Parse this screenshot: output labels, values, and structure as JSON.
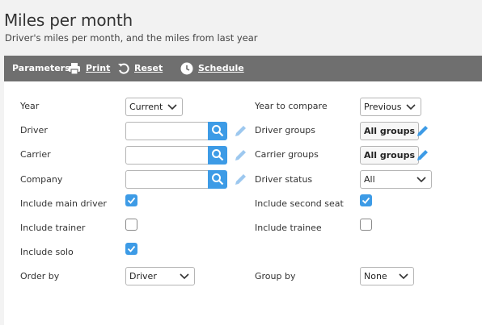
{
  "header": {
    "title": "Miles per month",
    "subtitle": "Driver's miles per month, and the miles from last year"
  },
  "toolbar": {
    "parameters_label": "Parameters",
    "print_label": "Print",
    "reset_label": "Reset",
    "schedule_label": "Schedule"
  },
  "form": {
    "year": {
      "label": "Year",
      "value": "Current"
    },
    "year_to_compare": {
      "label": "Year to compare",
      "value": "Previous"
    },
    "driver": {
      "label": "Driver",
      "value": ""
    },
    "driver_groups": {
      "label": "Driver groups",
      "button": "All groups"
    },
    "carrier": {
      "label": "Carrier",
      "value": ""
    },
    "carrier_groups": {
      "label": "Carrier groups",
      "button": "All groups"
    },
    "company": {
      "label": "Company",
      "value": ""
    },
    "driver_status": {
      "label": "Driver status",
      "value": "All"
    },
    "include_main_driver": {
      "label": "Include main driver",
      "checked": true
    },
    "include_second_seat": {
      "label": "Include second seat",
      "checked": true
    },
    "include_trainer": {
      "label": "Include trainer",
      "checked": false
    },
    "include_trainee": {
      "label": "Include trainee",
      "checked": false
    },
    "include_solo": {
      "label": "Include solo",
      "checked": true
    },
    "order_by": {
      "label": "Order by",
      "value": "Driver"
    },
    "group_by": {
      "label": "Group by",
      "value": "None"
    }
  },
  "colors": {
    "toolbar_bg": "#6f6f6f",
    "accent": "#3d9be6",
    "pencil_active": "#3d9be6",
    "pencil_disabled": "#9dc8ef"
  },
  "icons": {
    "print": "printer-icon",
    "reset": "reset-icon",
    "schedule": "clock-icon",
    "search": "search-icon",
    "edit": "pencil-icon",
    "dropdown": "chevron-down-icon",
    "check": "checkmark-icon"
  }
}
